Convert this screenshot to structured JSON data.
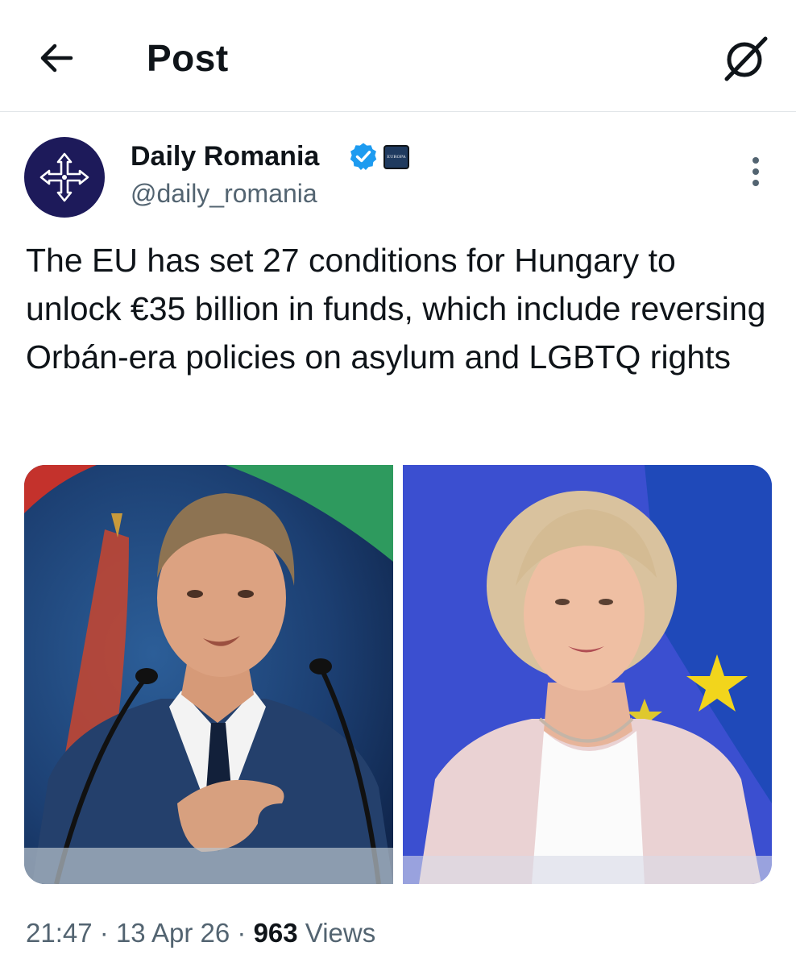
{
  "header": {
    "title": "Post",
    "back_icon": "arrow-left-icon",
    "grok_icon": "grok-icon"
  },
  "author": {
    "display_name": "Daily Romania",
    "handle": "@daily_romania",
    "verified": true,
    "verified_color": "#1d9bf0",
    "affiliate_badge_text": "EUROPA",
    "avatar_bg": "#1d1a5a"
  },
  "post": {
    "text": "The EU has set 27 conditions for Hungary to unlock €35 billion in funds, which include reversing Orbán-era policies on asylum and LGBTQ rights",
    "images": [
      {
        "alt": "Man in a navy suit speaking at a podium with microphones"
      },
      {
        "alt": "Woman in a light pink jacket smiling in front of an EU flag"
      }
    ]
  },
  "meta": {
    "time": "21:47",
    "separator": "·",
    "date": "13 Apr 26",
    "views_count": "963",
    "views_label": "Views"
  },
  "colors": {
    "text_primary": "#0f1419",
    "text_secondary": "#536471",
    "divider": "#e1e5e8"
  }
}
